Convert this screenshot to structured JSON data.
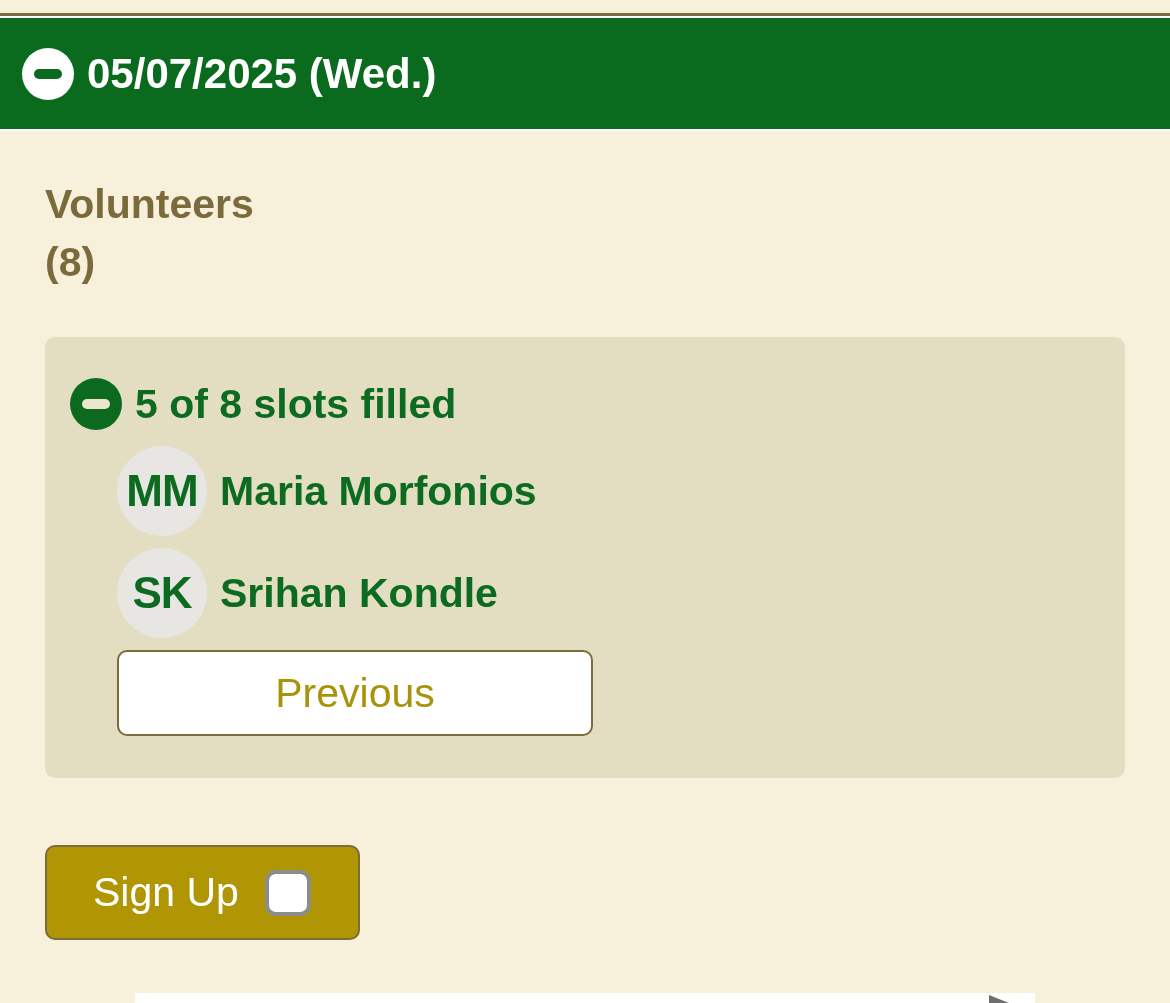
{
  "date_header": {
    "title": "05/07/2025 (Wed.)",
    "expanded": true
  },
  "volunteers": {
    "title": "Volunteers",
    "count": "(8)"
  },
  "slots": {
    "summary": "5 of 8 slots filled",
    "expanded": true,
    "people": [
      {
        "initials": "MM",
        "name": "Maria Morfonios"
      },
      {
        "initials": "SK",
        "name": "Srihan Kondle"
      }
    ],
    "previous_button": "Previous"
  },
  "sign_up": {
    "label": "Sign Up",
    "checked": false
  }
}
